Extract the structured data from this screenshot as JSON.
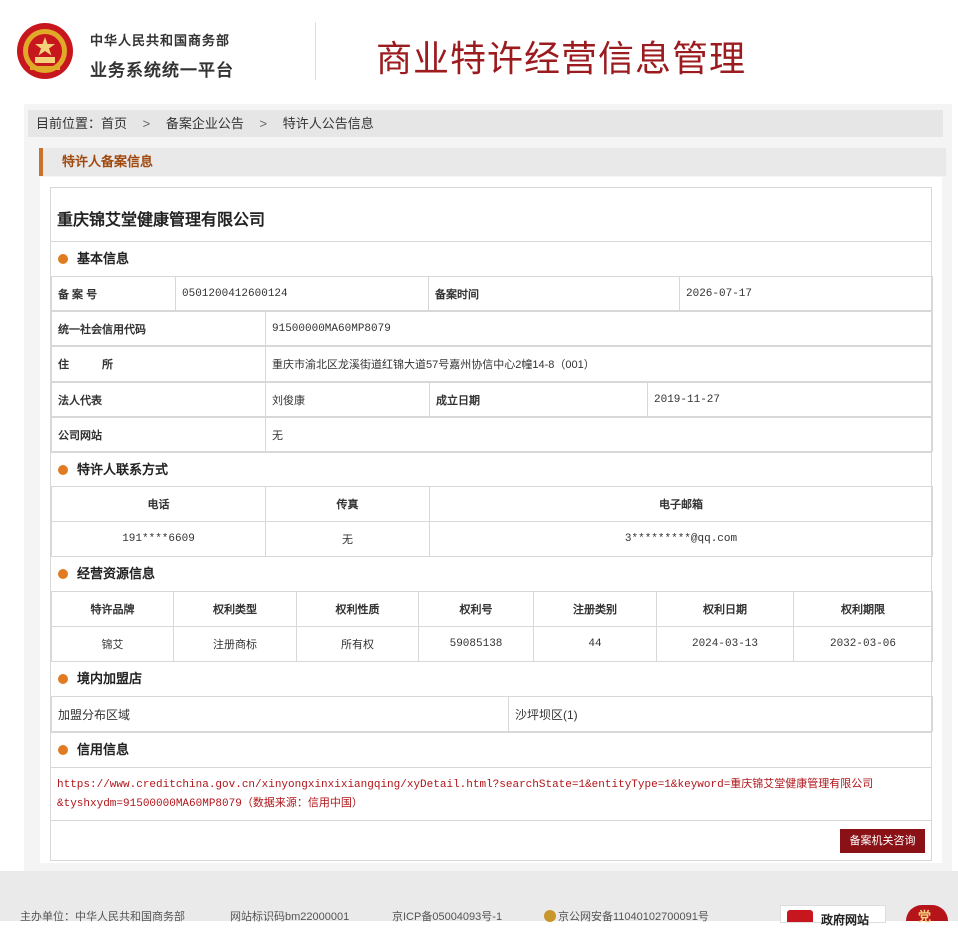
{
  "header": {
    "org_line1": "中华人民共和国商务部",
    "org_line2": "业务系统统一平台",
    "system_title": "商业特许经营信息管理"
  },
  "breadcrumb": {
    "prefix": "目前位置：",
    "items": [
      "首页",
      "备案企业公告",
      "特许人公告信息"
    ],
    "separator": ">"
  },
  "section_title": "特许人备案信息",
  "company_name": "重庆锦艾堂健康管理有限公司",
  "basic": {
    "heading": "基本信息",
    "record_no_label": "备 案 号",
    "record_no": "0501200412600124",
    "record_time_label": "备案时间",
    "record_time": "2026-07-17",
    "credit_code_label": "统一社会信用代码",
    "credit_code": "91500000MA60MP8079",
    "address_label": "住　　　所",
    "address": "重庆市渝北区龙溪街道红锦大道57号嘉州协信中心2幢14-8（001）",
    "legal_rep_label": "法人代表",
    "legal_rep": "刘俊康",
    "founded_label": "成立日期",
    "founded": "2019-11-27",
    "website_label": "公司网站",
    "website": "无"
  },
  "contact": {
    "heading": "特许人联系方式",
    "headers": [
      "电话",
      "传真",
      "电子邮箱"
    ],
    "phone": "191****6609",
    "fax": "无",
    "email": "3*********@qq.com"
  },
  "resources": {
    "heading": "经营资源信息",
    "headers": [
      "特许品牌",
      "权利类型",
      "权利性质",
      "权利号",
      "注册类别",
      "权利日期",
      "权利期限"
    ],
    "row": [
      "锦艾",
      "注册商标",
      "所有权",
      "59085138",
      "44",
      "2024-03-13",
      "2032-03-06"
    ]
  },
  "stores": {
    "heading": "境内加盟店",
    "label": "加盟分布区域",
    "value": "沙坪坝区(1)"
  },
  "credit": {
    "heading": "信用信息",
    "line1": "https://www.creditchina.gov.cn/xinyongxinxixiangqing/xyDetail.html?searchState=1&entityType=1&keyword=重庆锦艾堂健康管理有限公司",
    "line2": "&tyshxydm=91500000MA60MP8079（数据来源：信用中国）"
  },
  "consult_button": "备案机关咨询",
  "footer": {
    "sponsor": "主办单位：中华人民共和国商务部",
    "site_id": "网站标识码bm22000001",
    "icp": "京ICP备05004093号-1",
    "police": "京公网安备11040102700091号",
    "gov_badge": "政府网站",
    "party_badge": "党"
  },
  "colors": {
    "brand_red": "#9b1b1f",
    "accent_orange": "#e07b22",
    "button_red": "#8a1216"
  }
}
